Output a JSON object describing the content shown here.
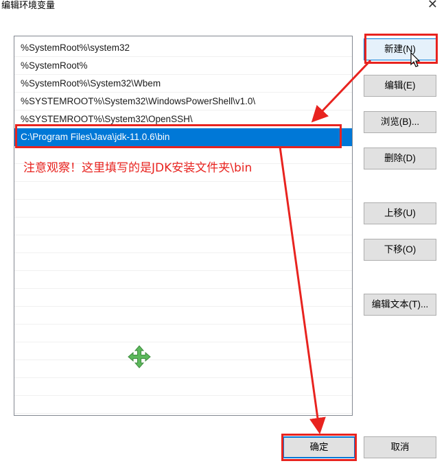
{
  "dialog": {
    "title": "编辑环境变量",
    "close_glyph": "✕",
    "close_icon": "close-icon"
  },
  "path_list": {
    "items": [
      "%SystemRoot%\\system32",
      "%SystemRoot%",
      "%SystemRoot%\\System32\\Wbem",
      "%SYSTEMROOT%\\System32\\WindowsPowerShell\\v1.0\\",
      "%SYSTEMROOT%\\System32\\OpenSSH\\",
      "C:\\Program Files\\Java\\jdk-11.0.6\\bin"
    ],
    "selected_index": 5
  },
  "buttons": {
    "new": "新建(N)",
    "edit": "编辑(E)",
    "browse": "浏览(B)...",
    "delete": "删除(D)",
    "move_up": "上移(U)",
    "move_down": "下移(O)",
    "edit_text": "编辑文本(T)...",
    "ok": "确定",
    "cancel": "取消"
  },
  "annotation": {
    "text": "注意观察！这里填写的是JDK安装文件夹\\bin",
    "color": "#e8231f"
  },
  "colors": {
    "selection": "#0078d7",
    "annotation_red": "#e8231f",
    "move_cursor_green": "#5cb85c"
  },
  "icons": {
    "move_cursor": "move-cursor-icon",
    "mouse_pointer": "mouse-pointer-icon"
  }
}
